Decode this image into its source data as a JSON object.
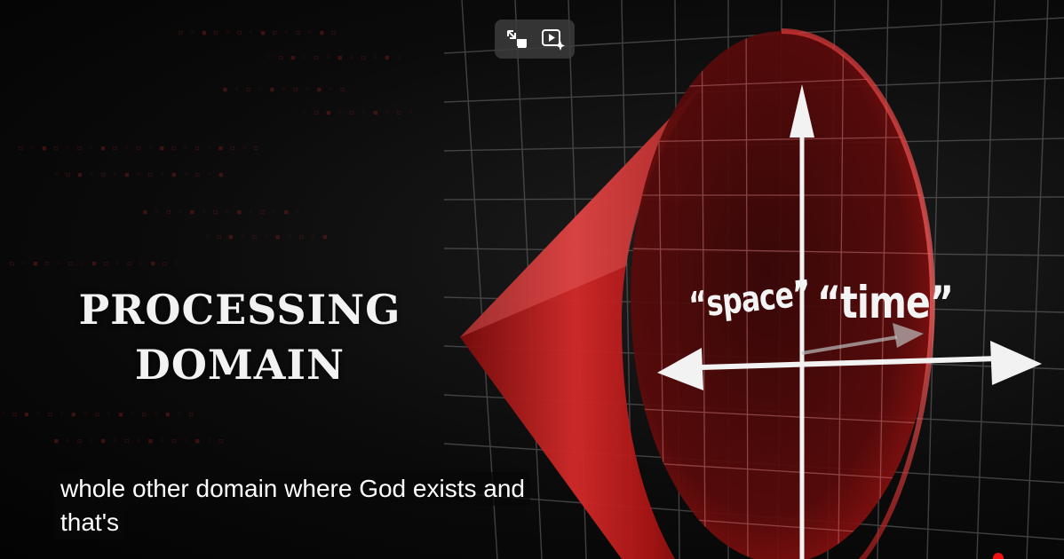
{
  "video": {
    "title_lines": [
      "PROCESSING",
      "DOMAIN"
    ],
    "axis_labels": {
      "space": "“space”",
      "time": "“time”"
    },
    "captions": [
      "whole other domain where God exists and",
      "that's"
    ]
  },
  "controls": {
    "exit_pip_icon": "exit-picture-in-picture-icon",
    "autoplay_icon": "video-sparkle-icon"
  },
  "colors": {
    "cone_red": "#c41a1a",
    "background": "#050505",
    "grid": "#8a8a8a",
    "progress": "#ee1111"
  }
}
